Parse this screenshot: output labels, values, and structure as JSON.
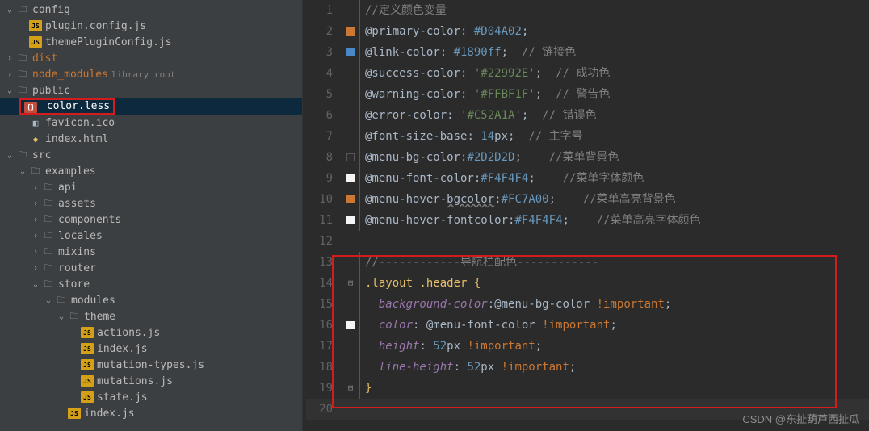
{
  "tree": {
    "config": {
      "label": "config"
    },
    "plugin_config": {
      "label": "plugin.config.js"
    },
    "theme_plugin": {
      "label": "themePluginConfig.js"
    },
    "dist": {
      "label": "dist"
    },
    "node_modules": {
      "label": "node_modules",
      "tag": "library root"
    },
    "public": {
      "label": "public"
    },
    "color_less": {
      "label": "color.less"
    },
    "favicon": {
      "label": "favicon.ico"
    },
    "index_html": {
      "label": "index.html"
    },
    "src": {
      "label": "src"
    },
    "examples": {
      "label": "examples"
    },
    "api": {
      "label": "api"
    },
    "assets": {
      "label": "assets"
    },
    "components": {
      "label": "components"
    },
    "locales": {
      "label": "locales"
    },
    "mixins": {
      "label": "mixins"
    },
    "router": {
      "label": "router"
    },
    "store": {
      "label": "store"
    },
    "modules": {
      "label": "modules"
    },
    "theme": {
      "label": "theme"
    },
    "actions": {
      "label": "actions.js"
    },
    "index_js": {
      "label": "index.js"
    },
    "mutation_types": {
      "label": "mutation-types.js"
    },
    "mutations": {
      "label": "mutations.js"
    },
    "state": {
      "label": "state.js"
    },
    "index_js2": {
      "label": "index.js"
    }
  },
  "code": {
    "l1_comment": "//定义颜色变量",
    "l2_var": "@primary-color",
    "l2_val": "#D04A02",
    "l3_var": "@link-color",
    "l3_val": "#1890ff",
    "l3_c": "// 链接色",
    "l4_var": "@success-color",
    "l4_val": "'#22992E'",
    "l4_c": "// 成功色",
    "l5_var": "@warning-color",
    "l5_val": "'#FFBF1F'",
    "l5_c": "// 警告色",
    "l6_var": "@error-color",
    "l6_val": "'#C52A1A'",
    "l6_c": "// 错误色",
    "l7_var": "@font-size-base",
    "l7_num": "14",
    "l7_unit": "px",
    "l7_c": "// 主字号",
    "l8_var": "@menu-bg-color",
    "l8_val": "#2D2D2D",
    "l8_c": "//菜单背景色",
    "l9_var": "@menu-font-color",
    "l9_val": "#F4F4F4",
    "l9_c": "//菜单字体颜色",
    "l10_var": "@menu-hover-",
    "l10_var2": "bgcolor",
    "l10_val": "#FC7A00",
    "l10_c": "//菜单高亮背景色",
    "l11_var": "@menu-hover-fontcolor",
    "l11_val": "#F4F4F4",
    "l11_c": "//菜单高亮字体颜色",
    "l13_c": "//------------导航栏配色------------",
    "l14_sel": ".layout .header {",
    "l15_prop": "background-color",
    "l15_val": "@menu-bg-color",
    "l15_imp": "!important",
    "l16_prop": "color",
    "l16_val": "@menu-font-color",
    "l16_imp": "!important",
    "l17_prop": "height",
    "l17_num": "52",
    "l17_unit": "px",
    "l17_imp": "!important",
    "l18_prop": "line-height",
    "l18_num": "52",
    "l18_unit": "px",
    "l18_imp": "!important",
    "l19": "}"
  },
  "marks": {
    "orange": "#cc7832",
    "blue": "#4a88c7",
    "dark": "#2d2d2d",
    "white": "#f4f4f4"
  },
  "watermark": "CSDN @东扯葫芦西扯瓜",
  "ln": {
    "1": "1",
    "2": "2",
    "3": "3",
    "4": "4",
    "5": "5",
    "6": "6",
    "7": "7",
    "8": "8",
    "9": "9",
    "10": "10",
    "11": "11",
    "12": "12",
    "13": "13",
    "14": "14",
    "15": "15",
    "16": "16",
    "17": "17",
    "18": "18",
    "19": "19",
    "20": "20"
  }
}
